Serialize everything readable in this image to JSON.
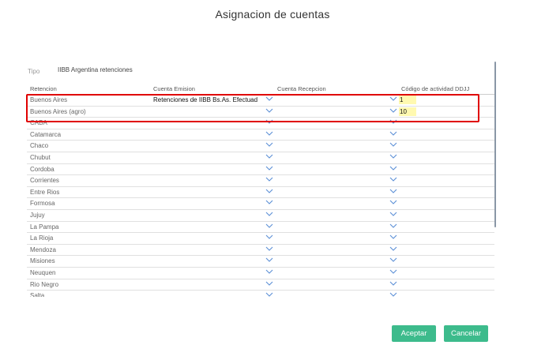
{
  "dialog": {
    "title": "Asignacion de cuentas"
  },
  "tipo": {
    "label": "Tipo",
    "value": "IIBB Argentina retenciones"
  },
  "grid": {
    "headers": {
      "retencion": "Retencion",
      "emision": "Cuenta Emision",
      "recepcion": "Cuenta Recepcion",
      "codigo": "Código de actividad DDJJ"
    },
    "rows": [
      {
        "name": "Buenos Aires",
        "emision": "Retenciones de IIBB Bs.As. Efectuad",
        "codigo": "1"
      },
      {
        "name": "Buenos Aires (agro)",
        "emision": "",
        "codigo": "10"
      },
      {
        "name": "CABA",
        "emision": ""
      },
      {
        "name": "Catamarca",
        "emision": ""
      },
      {
        "name": "Chaco",
        "emision": ""
      },
      {
        "name": "Chubut",
        "emision": ""
      },
      {
        "name": "Cordoba",
        "emision": ""
      },
      {
        "name": "Corrientes",
        "emision": ""
      },
      {
        "name": "Entre Rios",
        "emision": ""
      },
      {
        "name": "Formosa",
        "emision": ""
      },
      {
        "name": "Jujuy",
        "emision": ""
      },
      {
        "name": "La Pampa",
        "emision": ""
      },
      {
        "name": "La Rioja",
        "emision": ""
      },
      {
        "name": "Mendoza",
        "emision": ""
      },
      {
        "name": "Misiones",
        "emision": ""
      },
      {
        "name": "Neuquen",
        "emision": ""
      },
      {
        "name": "Rio Negro",
        "emision": ""
      },
      {
        "name": "Salta",
        "emision": ""
      }
    ]
  },
  "buttons": {
    "accept": "Aceptar",
    "cancel": "Cancelar"
  },
  "colors": {
    "accent": "#3dbb8c",
    "highlight": "#e00000",
    "code_field": "#fff9b0",
    "chevron": "#5b8fd6"
  }
}
